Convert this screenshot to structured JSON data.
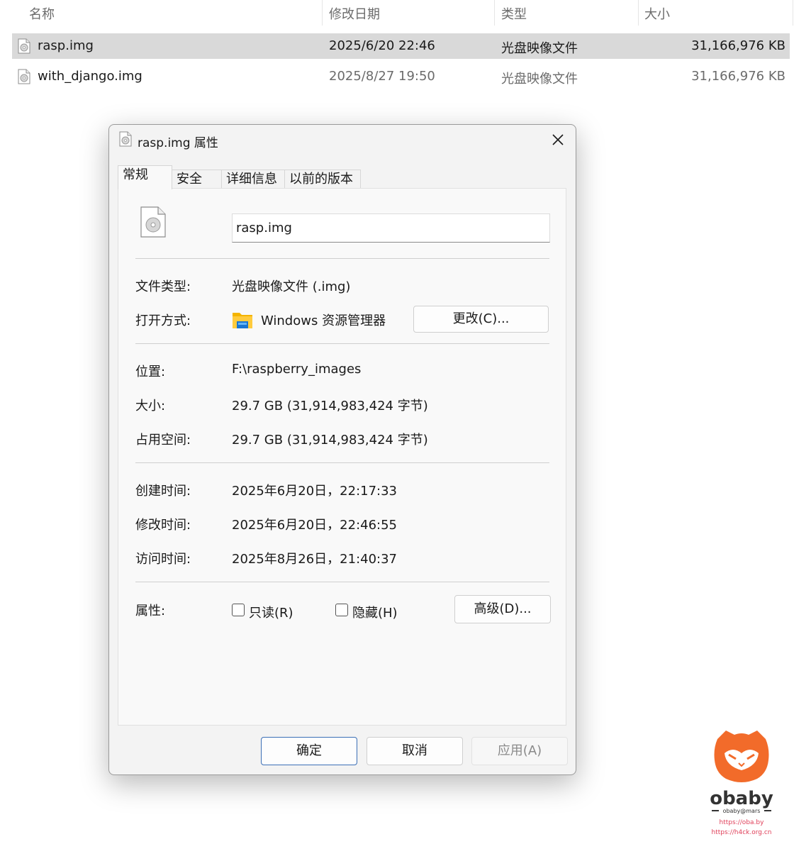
{
  "explorer": {
    "columns": [
      "名称",
      "修改日期",
      "类型",
      "大小"
    ],
    "sort_indicator": "^",
    "rows": [
      {
        "name": "rasp.img",
        "date": "2025/6/20 22:46",
        "type": "光盘映像文件",
        "size": "31,166,976 KB",
        "selected": true
      },
      {
        "name": "with_django.img",
        "date": "2025/8/27 19:50",
        "type": "光盘映像文件",
        "size": "31,166,976 KB",
        "selected": false
      }
    ]
  },
  "dialog": {
    "title": "rasp.img 属性",
    "tabs": [
      "常规",
      "安全",
      "详细信息",
      "以前的版本"
    ],
    "active_tab": "常规",
    "file_name": "rasp.img",
    "labels": {
      "file_type": "文件类型:",
      "open_with": "打开方式:",
      "location": "位置:",
      "size": "大小:",
      "size_on_disk": "占用空间:",
      "created": "创建时间:",
      "modified": "修改时间:",
      "accessed": "访问时间:",
      "attributes": "属性:"
    },
    "values": {
      "file_type": "光盘映像文件 (.img)",
      "open_with": "Windows 资源管理器",
      "location": "F:\\raspberry_images",
      "size": "29.7 GB (31,914,983,424 字节)",
      "size_on_disk": "29.7 GB (31,914,983,424 字节)",
      "created": "2025年6月20日，22:17:33",
      "modified": "2025年6月20日，22:46:55",
      "accessed": "2025年8月26日，21:40:37"
    },
    "attributes": {
      "readonly": {
        "label": "只读(R)",
        "checked": false
      },
      "hidden": {
        "label": "隐藏(H)",
        "checked": false
      }
    },
    "buttons": {
      "change": "更改(C)...",
      "advanced": "高级(D)...",
      "ok": "确定",
      "cancel": "取消",
      "apply": "应用(A)"
    }
  },
  "watermark": {
    "brand": "obaby",
    "handle": "obaby@mars",
    "url1": "https://oba.by",
    "url2": "https://h4ck.org.cn",
    "brand_color": "#f26b2a",
    "url_color": "#e0405a"
  }
}
